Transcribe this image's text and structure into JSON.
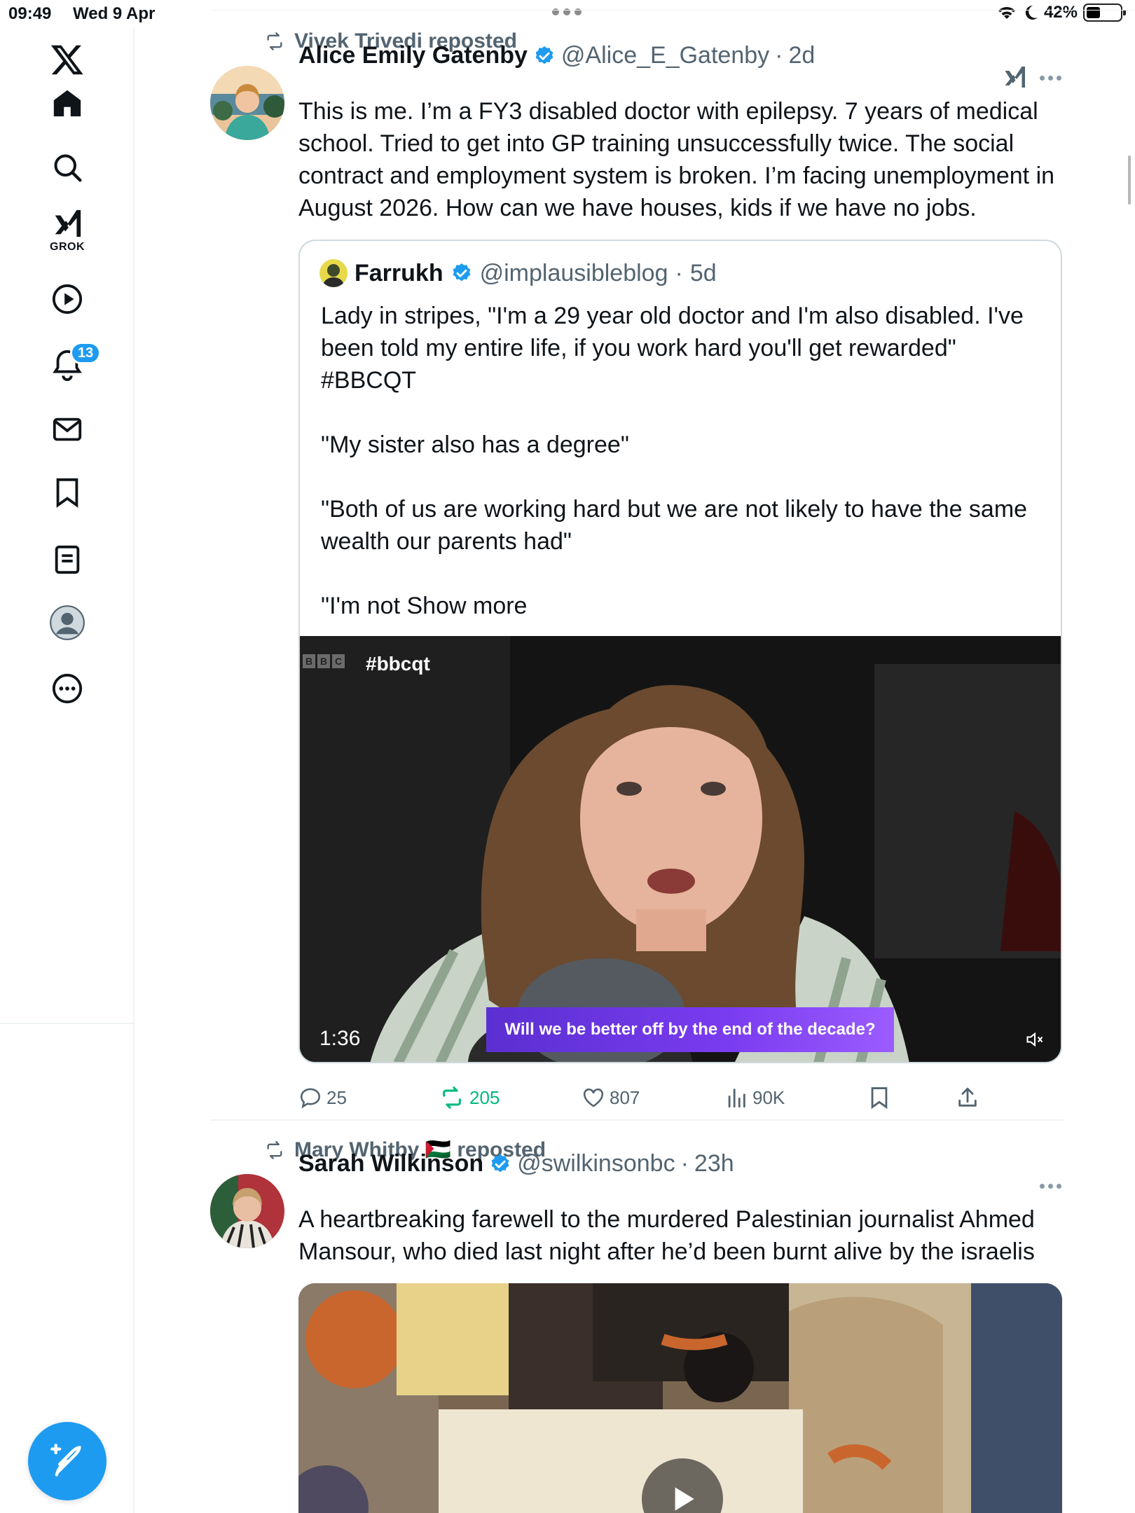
{
  "status_bar": {
    "time": "09:49",
    "date": "Wed 9 Apr",
    "battery": "42%",
    "battery_level": 0.42
  },
  "sidebar": {
    "grok_label": "GROK",
    "notifications_badge": "13",
    "items": [
      "x-logo",
      "home-icon",
      "search-icon",
      "grok-icon",
      "video-icon",
      "notifications-icon",
      "messages-icon",
      "bookmarks-icon",
      "lists-icon",
      "profile-icon",
      "more-icon"
    ]
  },
  "feed": {
    "post1": {
      "reposted_by": "Vivek Trivedi reposted",
      "name": "Alice Emily Gatenby",
      "handle": "@Alice_E_Gatenby",
      "time": "2d",
      "text": "This is me. I’m a FY3 disabled doctor with epilepsy. 7 years of medical school. Tried to get into GP training unsuccessfully twice. The social contract and employment system is broken. I’m facing unemployment in August 2026. How can we have houses, kids if we have no jobs.",
      "quote": {
        "name": "Farrukh",
        "handle": "@implausibleblog",
        "time": "5d",
        "text": "Lady in stripes, \"I'm a 29 year old doctor and I'm also disabled. I've been told my entire life, if you work hard you'll get rewarded\"\n#BBCQT\n\n\"My sister also has a degree\"\n\n\"Both of us are working hard but we are not likely to have the same wealth our parents had\"\n\n\"I'm not ",
        "show_more": "Show more",
        "video": {
          "hashtag": "#bbcqt",
          "bbc": [
            "B",
            "B",
            "C"
          ],
          "caption": "Will we be better off by the end of the decade?",
          "duration": "1:36"
        }
      },
      "actions": {
        "replies": "25",
        "reposts": "205",
        "likes": "807",
        "views": "90K"
      }
    },
    "post2": {
      "reposted_by": "Mary Whitby 🇵🇸 reposted",
      "name": "Sarah Wilkinson",
      "handle": "@swilkinsonbc",
      "time": "23h",
      "text": "A heartbreaking farewell to the murdered Palestinian journalist Ahmed Mansour, who died last night after he’d been burnt alive by the israelis"
    }
  },
  "colors": {
    "accent": "#1d9bf0",
    "repost_green": "#00ba7c",
    "secondary_text": "#536471",
    "border": "#cfd9de"
  }
}
